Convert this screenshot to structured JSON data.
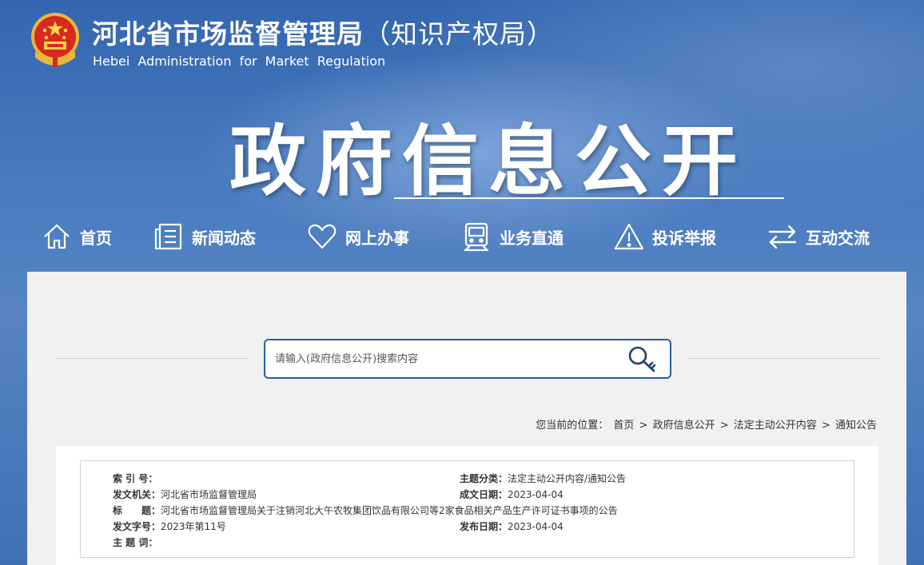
{
  "header": {
    "title": "河北省市场监督管理局",
    "title_suffix": "（知识产权局）",
    "subtitle_en": "Hebei Administration for Market Regulation",
    "emblem": "national-emblem-icon"
  },
  "hero": {
    "title": "政府信息公开"
  },
  "nav": {
    "items": [
      {
        "label": "首页",
        "icon": "home-icon"
      },
      {
        "label": "新闻动态",
        "icon": "news-icon"
      },
      {
        "label": "网上办事",
        "icon": "heart-icon"
      },
      {
        "label": "业务直通",
        "icon": "train-icon"
      },
      {
        "label": "投诉举报",
        "icon": "warning-icon"
      },
      {
        "label": "互动交流",
        "icon": "exchange-icon"
      }
    ]
  },
  "search": {
    "placeholder": "请输入(政府信息公开)搜索内容",
    "icon": "search-key-icon"
  },
  "breadcrumb": {
    "prefix": "您当前的位置：",
    "items": [
      "首页",
      "政府信息公开",
      "法定主动公开内容",
      "通知公告"
    ],
    "separator": ">"
  },
  "meta": {
    "index_no": {
      "label": "索 引 号：",
      "value": ""
    },
    "topic": {
      "label": "主题分类：",
      "value": "法定主动公开内容/通知公告"
    },
    "issuer": {
      "label": "发文机关：",
      "value": "河北省市场监督管理局"
    },
    "created": {
      "label": "成文日期：",
      "value": "2023-04-04"
    },
    "title": {
      "label": "标　　题：",
      "value": "河北省市场监督管理局关于注销河北大午农牧集团饮品有限公司等2家食品相关产品生产许可证书事项的公告"
    },
    "doc_no": {
      "label": "发文字号：",
      "value": "2023年第11号"
    },
    "published": {
      "label": "发布日期：",
      "value": "2023-04-04"
    },
    "keywords": {
      "label": "主 题 词：",
      "value": ""
    }
  },
  "colors": {
    "brand_blue": "#2a5ea8",
    "banner_blue": "#3d6fb8",
    "content_bg": "#f1f1f1"
  }
}
